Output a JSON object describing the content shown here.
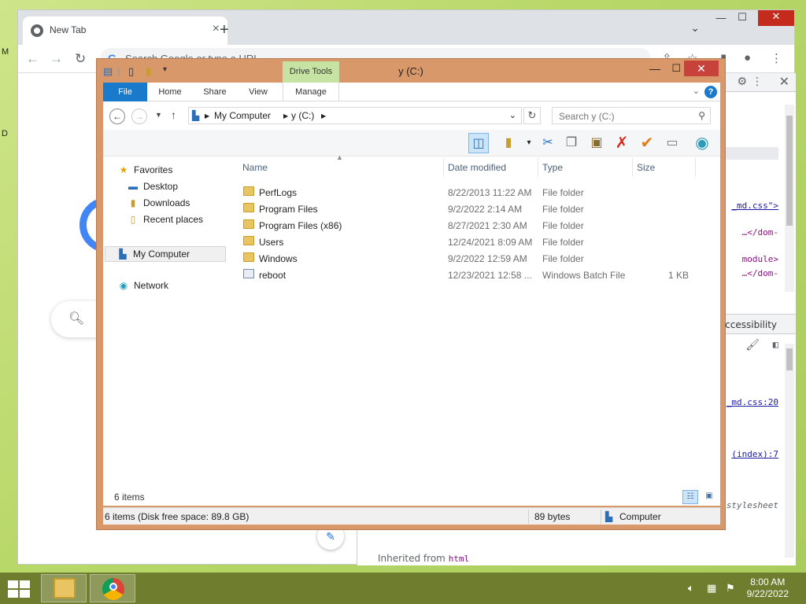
{
  "desktop": {
    "edge_letters": [
      "M",
      "D"
    ]
  },
  "chrome": {
    "tab_title": "New Tab",
    "tab_close": "×",
    "new_tab": "+",
    "omnibox_placeholder": "Search Google or type a URL",
    "omnibox_g": "G",
    "devtools": {
      "lines": [
        {
          "text": "_md.css\">",
          "link": true
        },
        {
          "text": "…</dom-",
          "link": false
        },
        {
          "text": "module>",
          "link": false
        },
        {
          "text": "…</dom-",
          "link": false
        }
      ],
      "accessibility_tab": "Accessibility",
      "styles_lines": [
        {
          "text": "_md.css:20",
          "link": true
        },
        {
          "text": "(index):7",
          "link": true
        },
        {
          "text": "stylesheet",
          "link": false
        }
      ],
      "inherited_label": "Inherited from",
      "inherited_tag": "html"
    }
  },
  "explorer": {
    "title": "y (C:)",
    "drive_tools": "Drive Tools",
    "ribbon_tabs": [
      "File",
      "Home",
      "Share",
      "View",
      "Manage"
    ],
    "breadcrumb": [
      "My Computer",
      "y (C:)"
    ],
    "search_placeholder": "Search y (C:)",
    "nav": {
      "favorites": "Favorites",
      "favorites_items": [
        "Desktop",
        "Downloads",
        "Recent places"
      ],
      "computer": "My Computer",
      "network": "Network"
    },
    "columns": [
      "Name",
      "Date modified",
      "Type",
      "Size"
    ],
    "files": [
      {
        "name": "PerfLogs",
        "date": "8/22/2013 11:22 AM",
        "type": "File folder",
        "size": "",
        "kind": "folder"
      },
      {
        "name": "Program Files",
        "date": "9/2/2022 2:14 AM",
        "type": "File folder",
        "size": "",
        "kind": "folder"
      },
      {
        "name": "Program Files (x86)",
        "date": "8/27/2021 2:30 AM",
        "type": "File folder",
        "size": "",
        "kind": "folder"
      },
      {
        "name": "Users",
        "date": "12/24/2021 8:09 AM",
        "type": "File folder",
        "size": "",
        "kind": "folder"
      },
      {
        "name": "Windows",
        "date": "9/2/2022 12:59 AM",
        "type": "File folder",
        "size": "",
        "kind": "folder"
      },
      {
        "name": "reboot",
        "date": "12/23/2021 12:58 ...",
        "type": "Windows Batch File",
        "size": "1 KB",
        "kind": "bat"
      }
    ],
    "items_count": "6 items",
    "status": {
      "summary": "6 items (Disk free space: 89.8 GB)",
      "bytes": "89 bytes",
      "location": "Computer"
    }
  },
  "taskbar": {
    "time": "8:00 AM",
    "date": "9/22/2022"
  },
  "colors": {
    "file_tab": "#1979ca",
    "drive_tools": "#c7e3a3",
    "window_frame": "#d9986a",
    "taskbar": "#6f7d2e"
  }
}
